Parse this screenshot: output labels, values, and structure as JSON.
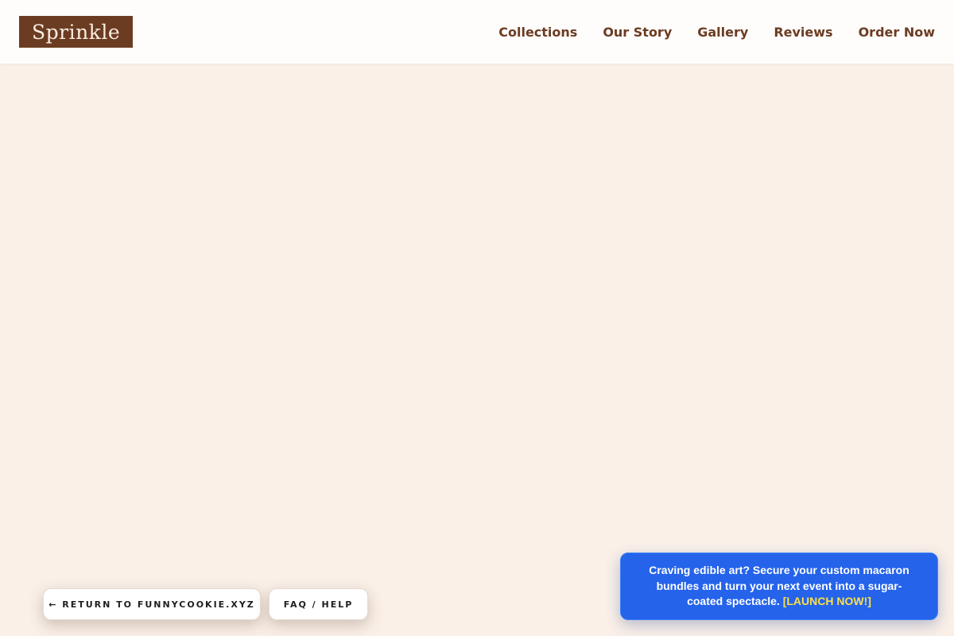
{
  "header": {
    "logo": "Sprinkle",
    "nav": [
      {
        "label": "Collections"
      },
      {
        "label": "Our Story"
      },
      {
        "label": "Gallery"
      },
      {
        "label": "Reviews"
      },
      {
        "label": "Order Now"
      }
    ]
  },
  "footer_buttons": {
    "return_label": "← RETURN TO FUNNYCOOKIE.XYZ",
    "faq_label": "FAQ / HELP"
  },
  "promo": {
    "message": "Craving edible art? Secure your custom macaron bundles and turn your next event into a sugar-coated spectacle.",
    "cta": "[LAUNCH NOW!]"
  },
  "colors": {
    "page_background": "#faf0e8",
    "header_background": "#fffdfb",
    "brand_brown": "#6b3c22",
    "promo_blue": "#2563eb",
    "promo_cta_yellow": "#fde047"
  }
}
